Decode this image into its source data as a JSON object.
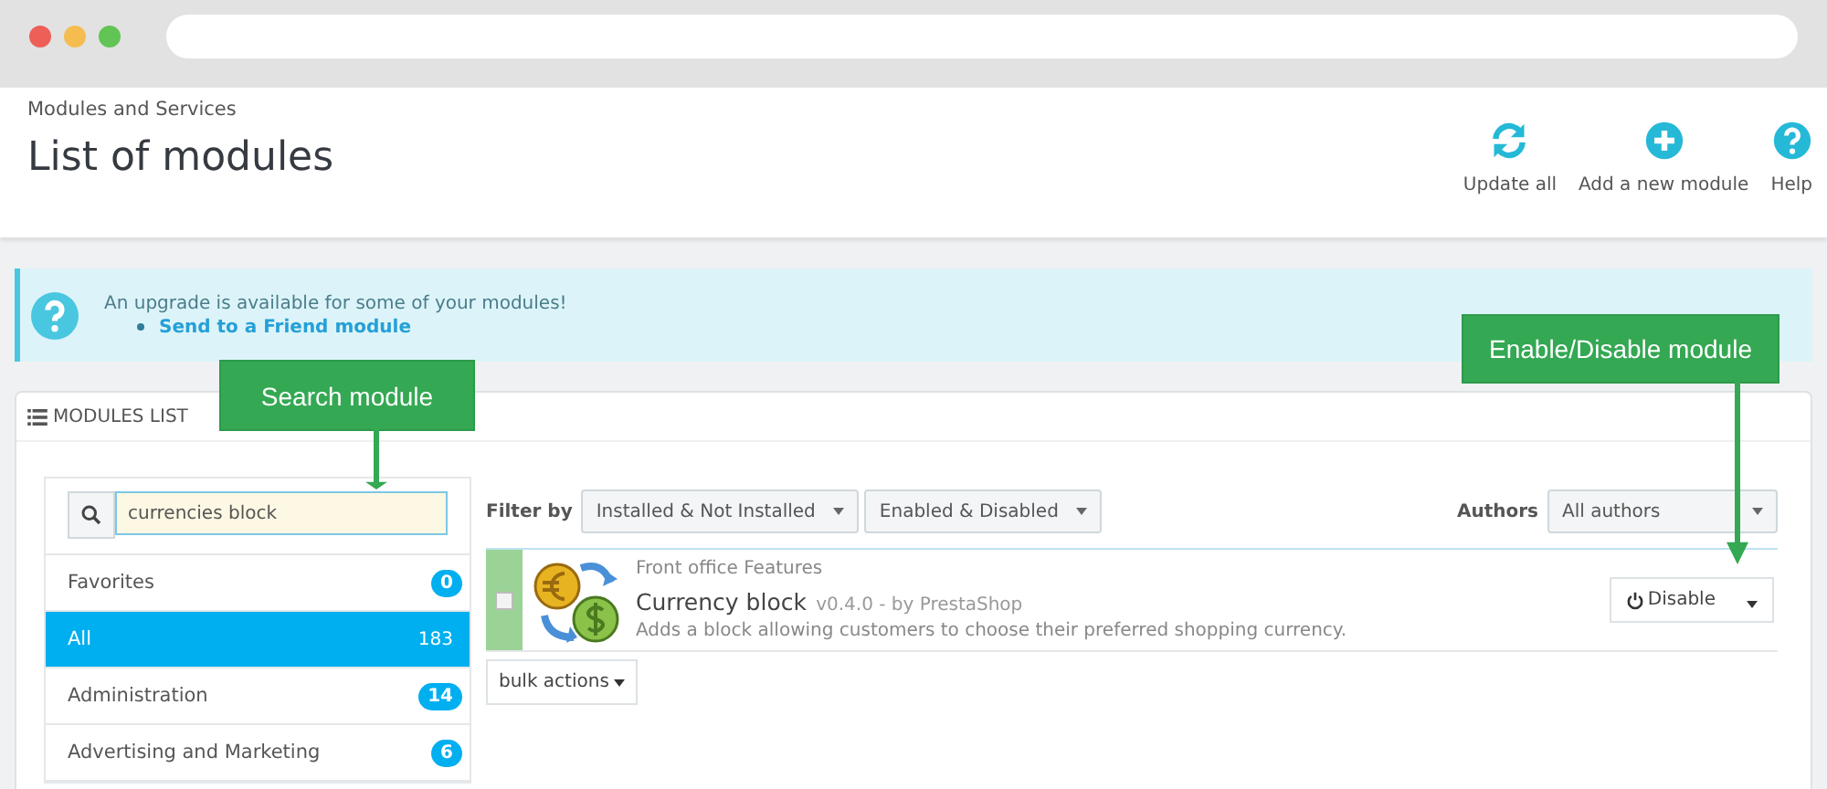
{
  "browser": {
    "dots": [
      {
        "color": "#ed5f57"
      },
      {
        "color": "#f5bd4f"
      },
      {
        "color": "#61c454"
      }
    ]
  },
  "header": {
    "breadcrumb": "Modules and Services",
    "title": "List of modules",
    "toolbar": [
      {
        "kind": "refresh",
        "label": "Update all"
      },
      {
        "kind": "add",
        "label": "Add a new module"
      },
      {
        "kind": "help",
        "label": "Help"
      }
    ]
  },
  "alert": {
    "message": "An upgrade is available for some of your modules!",
    "items": [
      "Send to a Friend module"
    ]
  },
  "panel": {
    "title": "MODULES LIST",
    "search": {
      "value": "currencies block"
    },
    "categories": [
      {
        "label": "Favorites",
        "count": "0",
        "selected": false
      },
      {
        "label": "All",
        "count": "183",
        "selected": true
      },
      {
        "label": "Administration",
        "count": "14",
        "selected": false
      },
      {
        "label": "Advertising and Marketing",
        "count": "6",
        "selected": false
      }
    ],
    "filters": {
      "label": "Filter by",
      "selects": [
        "Installed & Not Installed",
        "Enabled & Disabled"
      ],
      "authors_label": "Authors",
      "authors_select": "All authors"
    },
    "modules": [
      {
        "category": "Front office Features",
        "name": "Currency block",
        "version": "v0.4.0 - by PrestaShop",
        "description": "Adds a block allowing customers to choose their preferred shopping currency.",
        "checked": false,
        "action": "Disable"
      }
    ],
    "bulk_actions": "bulk actions"
  },
  "callouts": [
    {
      "kind": "search",
      "text": "Search module"
    },
    {
      "kind": "toggle",
      "text": "Enable/Disable module"
    }
  ]
}
